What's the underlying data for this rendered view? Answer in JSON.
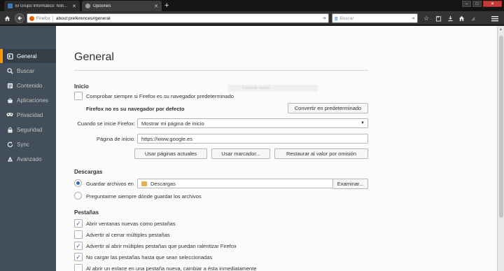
{
  "tabs": [
    {
      "title": "El Grupo Informático: Noti…",
      "close": "✕"
    },
    {
      "title": "Opciones",
      "close": "✕"
    }
  ],
  "new_tab": "+",
  "window_controls": {
    "minimize": "–",
    "maximize": "□",
    "close": "✕"
  },
  "navbar": {
    "identity_label": "Firefox",
    "url": "about:preferences#general",
    "search_placeholder": "Buscar",
    "search_engine_glyph": "g"
  },
  "sidebar": {
    "items": [
      {
        "label": "General",
        "icon": "switch-icon"
      },
      {
        "label": "Buscar",
        "icon": "search-icon"
      },
      {
        "label": "Contenido",
        "icon": "document-icon"
      },
      {
        "label": "Aplicaciones",
        "icon": "applications-icon"
      },
      {
        "label": "Privacidad",
        "icon": "mask-icon"
      },
      {
        "label": "Seguridad",
        "icon": "lock-icon"
      },
      {
        "label": "Sync",
        "icon": "sync-icon"
      },
      {
        "label": "Avanzado",
        "icon": "wizard-icon"
      }
    ],
    "active_index": 0
  },
  "main": {
    "title": "General",
    "ghost_text": "Escala de versión",
    "inicio": {
      "heading": "Inicio",
      "check_default_label": "Comprobar siempre si Firefox es su navegador predeterminado",
      "check_default_checked": false,
      "not_default_text": "Firefox no es su navegador por defecto",
      "make_default_button": "Convertir en predeterminado",
      "when_starts_label": "Cuando se inicie Firefox:",
      "when_starts_value": "Mostrar mi página de inicio",
      "homepage_label": "Página de inicio:",
      "homepage_value": "https://www.google.es",
      "use_current_button": "Usar páginas actuales",
      "use_bookmark_button": "Usar marcador...",
      "restore_default_button": "Restaurar al valor por omisión"
    },
    "descargas": {
      "heading": "Descargas",
      "save_files_label": "Guardar archivos en",
      "save_files_selected": true,
      "folder_value": "Descargas",
      "browse_button": "Examinar...",
      "always_ask_label": "Preguntarme siempre dónde guardar los archivos",
      "always_ask_selected": false
    },
    "pestanas": {
      "heading": "Pestañas",
      "options": [
        {
          "label": "Abrir ventanas nuevas como pestañas",
          "checked": true
        },
        {
          "label": "Advertir al cerrar múltiples pestañas",
          "checked": false
        },
        {
          "label": "Advertir al abrir múltiples pestañas que puedan ralentizar Firefox",
          "checked": true
        },
        {
          "label": "No cargar las pestañas hasta que sean seleccionadas",
          "checked": true
        },
        {
          "label": "Al abrir un enlace en una pestaña nueva, cambiar a ésta inmediatamente",
          "checked": false
        }
      ]
    }
  },
  "colors": {
    "accent": "#ff9500",
    "sidebar_bg": "#424f5a",
    "check_color": "#2a6ec4",
    "close_button": "#c43c35"
  }
}
